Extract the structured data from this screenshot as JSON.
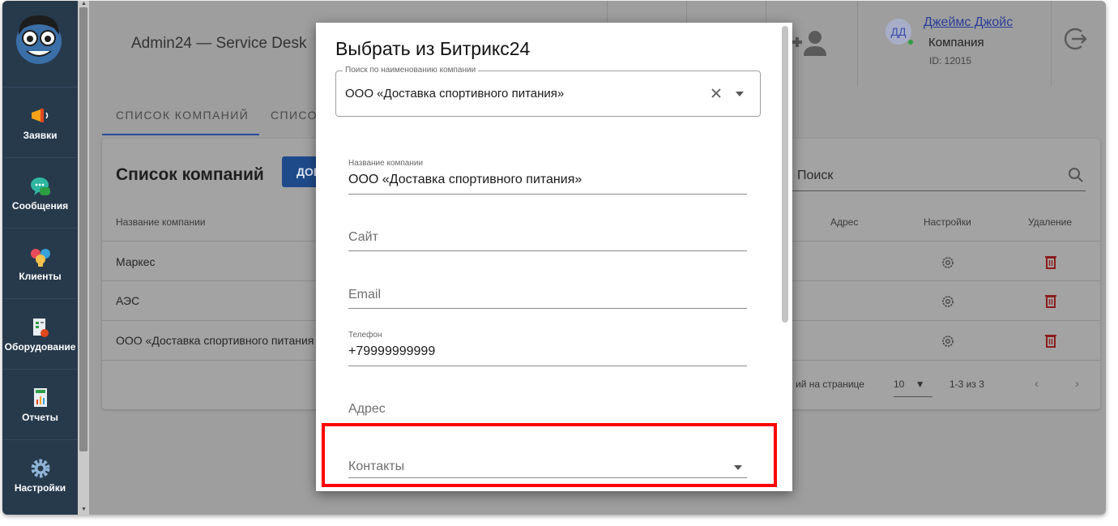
{
  "sidebar": {
    "items": [
      {
        "label": "Заявки",
        "icon": "megaphone-icon"
      },
      {
        "label": "Сообщения",
        "icon": "chat-bubble-icon"
      },
      {
        "label": "Клиенты",
        "icon": "clients-icon"
      },
      {
        "label": "Оборудование",
        "icon": "equipment-icon"
      },
      {
        "label": "Отчеты",
        "icon": "report-icon"
      },
      {
        "label": "Настройки",
        "icon": "gear-icon"
      }
    ]
  },
  "header": {
    "title": "Admin24 — Service Desk",
    "user": {
      "initials": "ДД",
      "name": "Джеймс Джойс",
      "role": "Компания",
      "id": "ID: 12015"
    }
  },
  "tabs": [
    {
      "label": "СПИСОК КОМПАНИЙ",
      "active": true
    },
    {
      "label": "СПИСО"
    }
  ],
  "companies": {
    "title": "Список компаний",
    "add_button": "ДОБ",
    "search_placeholder": "Поиск",
    "columns": {
      "name": "Название компании",
      "address": "Адрес",
      "settings": "Настройки",
      "delete": "Удаление"
    },
    "rows": [
      {
        "name": "Маркес"
      },
      {
        "name": "АЭС"
      },
      {
        "name": "ООО «Доставка спортивного питания"
      }
    ],
    "pager": {
      "rows_per_page": "ий на странице",
      "page_size": "10",
      "range": "1-3 из 3"
    }
  },
  "modal": {
    "title": "Выбрать из Битрикс24",
    "search": {
      "legend": "Поиск по наименованию компании",
      "value": "ООО «Доставка спортивного питания»"
    },
    "fields": {
      "company_name_label": "Название компании",
      "company_name_value": "ООО «Доставка спортивного питания»",
      "site_placeholder": "Сайт",
      "email_placeholder": "Email",
      "phone_label": "Телефон",
      "phone_value": "+79999999999",
      "address_placeholder": "Адрес",
      "contacts_placeholder": "Контакты"
    }
  },
  "colors": {
    "sidebar_bg": "#273a4c",
    "accent": "#2b4a9c",
    "delete": "#d32f2f",
    "highlight": "#ff0000"
  }
}
